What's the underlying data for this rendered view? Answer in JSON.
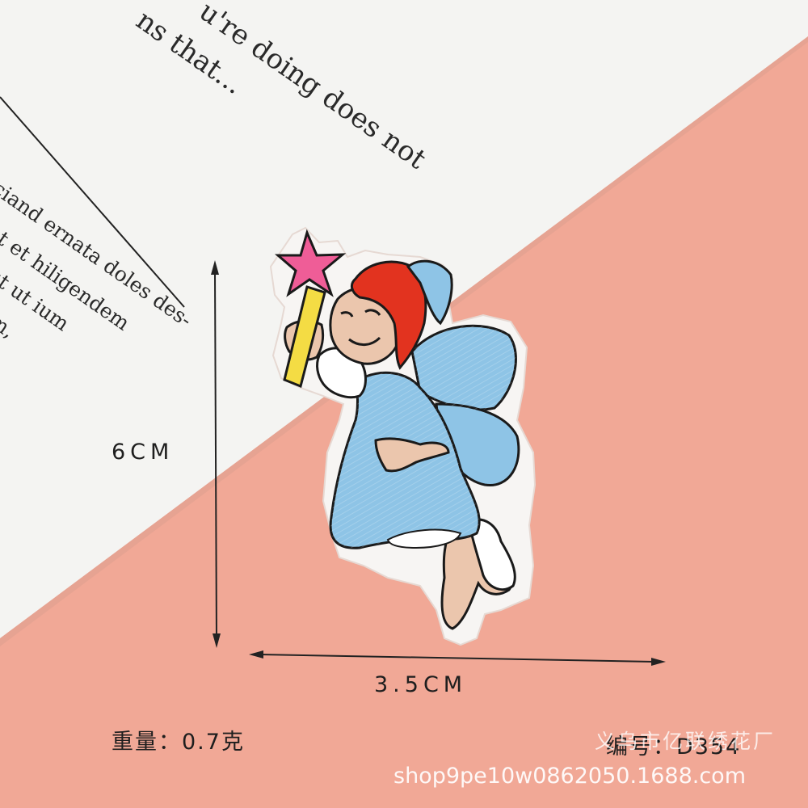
{
  "paper": {
    "quote_lines": [
      "u're doing does not",
      "ns that..."
    ],
    "body_lines": [
      "ciand ernata doles des-",
      "ot et hiligendem",
      "ut ut ium",
      "m,"
    ]
  },
  "dimensions": {
    "height_label": "6CM",
    "width_label": "3.5CM"
  },
  "product": {
    "weight_label": "重量：0.7克",
    "code_label": "编号：D354"
  },
  "watermark": {
    "shop_name": "义乌市亿联绣花厂",
    "url": "shop9pe10w0862050.1688.com"
  },
  "colors": {
    "background": "#f1a896",
    "paper": "#f3f3f1",
    "dress": "#8ec4e6",
    "hair": "#e2331f",
    "skin": "#ebc6ad",
    "star": "#ef5d97",
    "wand": "#f4dc44"
  }
}
